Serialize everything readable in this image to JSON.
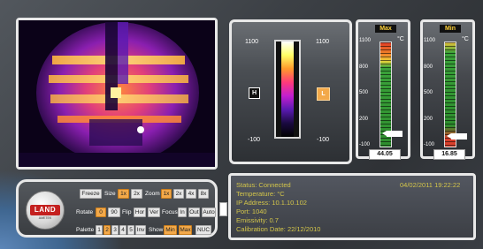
{
  "scale": {
    "max_left": "1100",
    "max_right": "1100",
    "min_left": "-100",
    "min_right": "-100",
    "hi_marker": "H",
    "lo_marker": "L",
    "colors": [
      "#ffffff",
      "#ffff66",
      "#ff9a2a",
      "#ff3a7a",
      "#c21fd0",
      "#5a1ab0",
      "#1a0a40",
      "#000000"
    ]
  },
  "gauge_max": {
    "title": "Max",
    "unit": "°C",
    "ticks": [
      "1100",
      "800",
      "500",
      "200",
      "-100"
    ],
    "value": "44.05",
    "value_num": 44.05,
    "range": [
      -100,
      1100
    ]
  },
  "gauge_min": {
    "title": "Min",
    "unit": "°C",
    "ticks": [
      "1100",
      "800",
      "500",
      "200",
      "-100"
    ],
    "value": "16.85",
    "value_num": 16.85,
    "range": [
      -100,
      1100
    ]
  },
  "logo": {
    "name": "LAND",
    "subtitle": "AMETEK"
  },
  "controls": {
    "freeze": "Freeze",
    "size_label": "Size",
    "size_1x": "1x",
    "size_2x": "2x",
    "zoom_label": "Zoom",
    "zoom_1x": "1x",
    "zoom_2x": "2x",
    "zoom_4x": "4x",
    "zoom_8x": "8x",
    "rotate_label": "Rotate",
    "rotate_0": "0",
    "rotate_90": "90",
    "flip_label": "Flip",
    "flip_hor": "Hor",
    "flip_ver": "Ver",
    "focus_label": "Focus",
    "focus_in": "In",
    "focus_out": "Out",
    "focus_auto": "Auto",
    "palette_label": "Palette",
    "palette_1": "1",
    "palette_2": "2",
    "palette_3": "3",
    "palette_4": "4",
    "palette_5": "5",
    "palette_inv": "Inv",
    "show_label": "Show",
    "show_min": "Min",
    "show_max": "Max",
    "nuc": "NUC"
  },
  "status": {
    "status": "Status: Connected",
    "datetime": "04/02/2011  19:22:22",
    "temperature": "Temperature:  °C",
    "ip": "IP Address: 10.1.10.102",
    "port": "Port: 1040",
    "emissivity": "Emissivity: 0.7",
    "calibration": "Calibration Date: 22/12/2010"
  }
}
